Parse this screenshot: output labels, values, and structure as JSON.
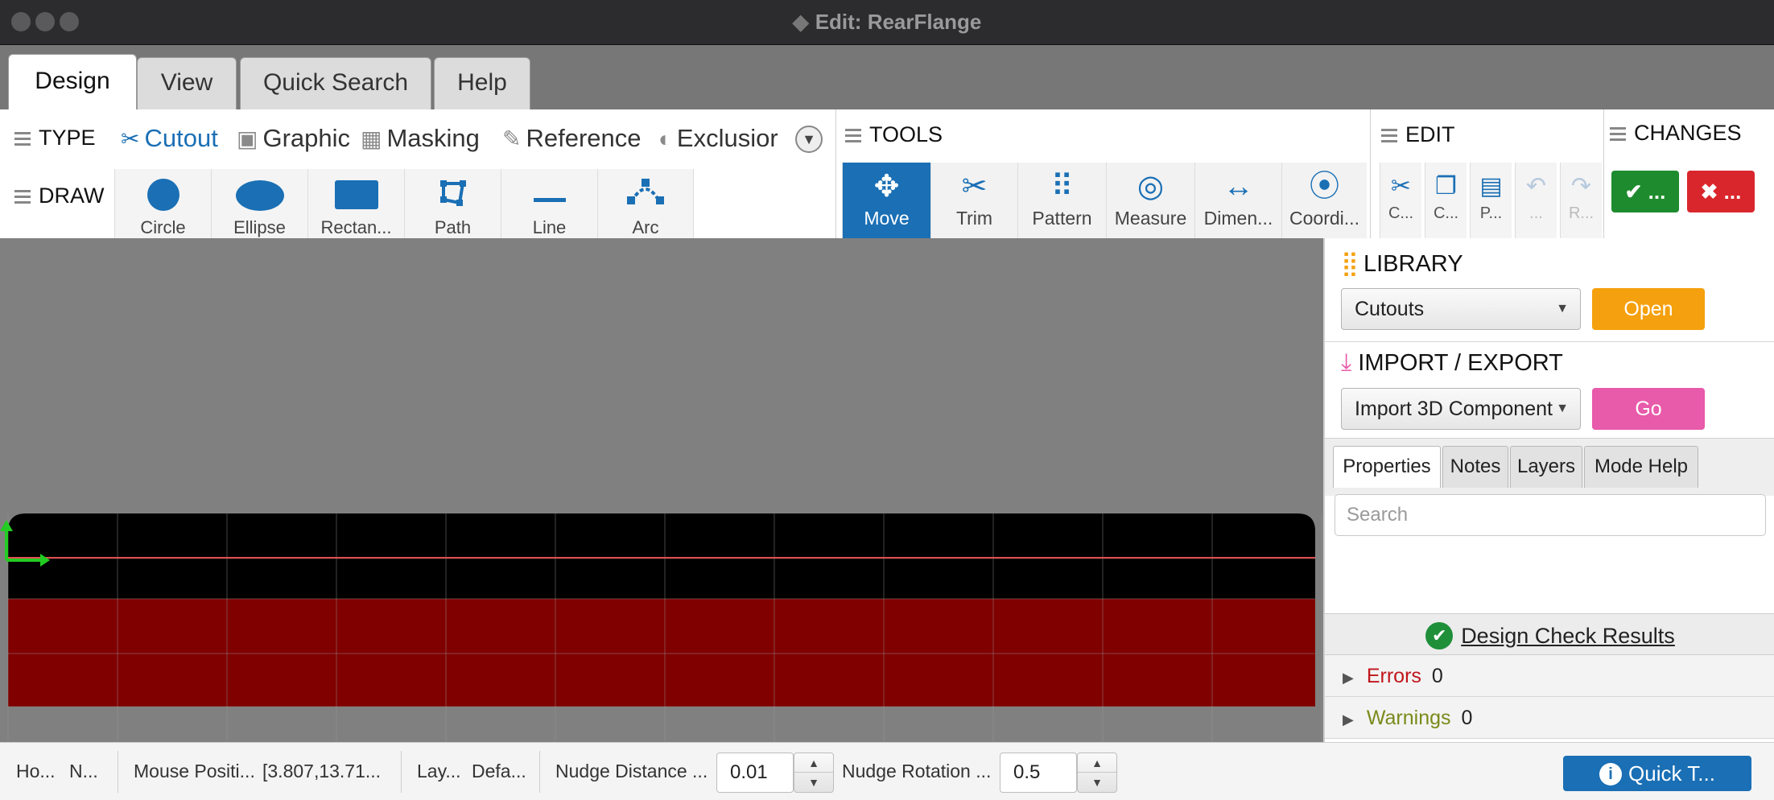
{
  "window": {
    "title": "Edit: RearFlange"
  },
  "main_tabs": [
    {
      "label": "Design"
    },
    {
      "label": "View"
    },
    {
      "label": "Quick Search"
    },
    {
      "label": "Help"
    }
  ],
  "type_section": {
    "label": "TYPE",
    "items": [
      {
        "label": "Cutout",
        "icon": "scissors-icon"
      },
      {
        "label": "Graphic",
        "icon": "graphic-icon"
      },
      {
        "label": "Masking",
        "icon": "masking-icon"
      },
      {
        "label": "Reference",
        "icon": "pencil-icon"
      },
      {
        "label": "Exclusior",
        "icon": "half-circle-icon"
      }
    ]
  },
  "draw_section": {
    "label": "DRAW",
    "items": [
      {
        "label": "Circle"
      },
      {
        "label": "Ellipse"
      },
      {
        "label": "Rectan..."
      },
      {
        "label": "Path"
      },
      {
        "label": "Line"
      },
      {
        "label": "Arc"
      }
    ]
  },
  "tools_section": {
    "label": "TOOLS",
    "items": [
      {
        "label": "Move",
        "glyph": "✥"
      },
      {
        "label": "Trim",
        "glyph": "✂"
      },
      {
        "label": "Pattern",
        "glyph": "⠿"
      },
      {
        "label": "Measure",
        "glyph": "◎"
      },
      {
        "label": "Dimen...",
        "glyph": "↔"
      },
      {
        "label": "Coordi...",
        "glyph": "⦿"
      }
    ]
  },
  "edit_section": {
    "label": "EDIT",
    "items": [
      {
        "label": "C...",
        "glyph": "✂"
      },
      {
        "label": "C...",
        "glyph": "❐"
      },
      {
        "label": "P...",
        "glyph": "▤"
      },
      {
        "label": "...",
        "glyph": "↶"
      },
      {
        "label": "R...",
        "glyph": "↷"
      }
    ]
  },
  "changes_section": {
    "label": "CHANGES",
    "accept_label": "✔ ...",
    "reject_label": "✖ ...",
    "accept_color": "#1e8c2e",
    "reject_color": "#d9262c"
  },
  "library": {
    "title": "LIBRARY",
    "selected": "Cutouts",
    "button": "Open",
    "button_color": "#f5a00e"
  },
  "import_export": {
    "title": "IMPORT / EXPORT",
    "selected": "Import 3D Component",
    "button": "Go",
    "button_color": "#e85aaa"
  },
  "panel_tabs": [
    {
      "label": "Properties"
    },
    {
      "label": "Notes"
    },
    {
      "label": "Layers"
    },
    {
      "label": "Mode Help"
    }
  ],
  "search": {
    "placeholder": "Search"
  },
  "design_check": {
    "title": "Design Check Results",
    "errors_label": "Errors",
    "errors_count": "0",
    "errors_color": "#c0161b",
    "warnings_label": "Warnings",
    "warnings_count": "0",
    "warnings_color": "#7a8a1a"
  },
  "status": {
    "ho_label": "Ho...",
    "ho_value": "N...",
    "mouse_label": "Mouse Positi...",
    "mouse_value": "[3.807,13.71...",
    "layer_label": "Lay...",
    "layer_value": "Defa...",
    "nudge_distance_label": "Nudge Distance ...",
    "nudge_distance_value": "0.01",
    "nudge_rotation_label": "Nudge Rotation ...",
    "nudge_rotation_value": "0.5",
    "quick_button": "Quick T..."
  },
  "colors": {
    "accent": "#1a6fb5",
    "canvas_bg": "#808080",
    "panel_black": "#000000",
    "panel_red": "#800000",
    "axis_green": "#22cc22"
  }
}
